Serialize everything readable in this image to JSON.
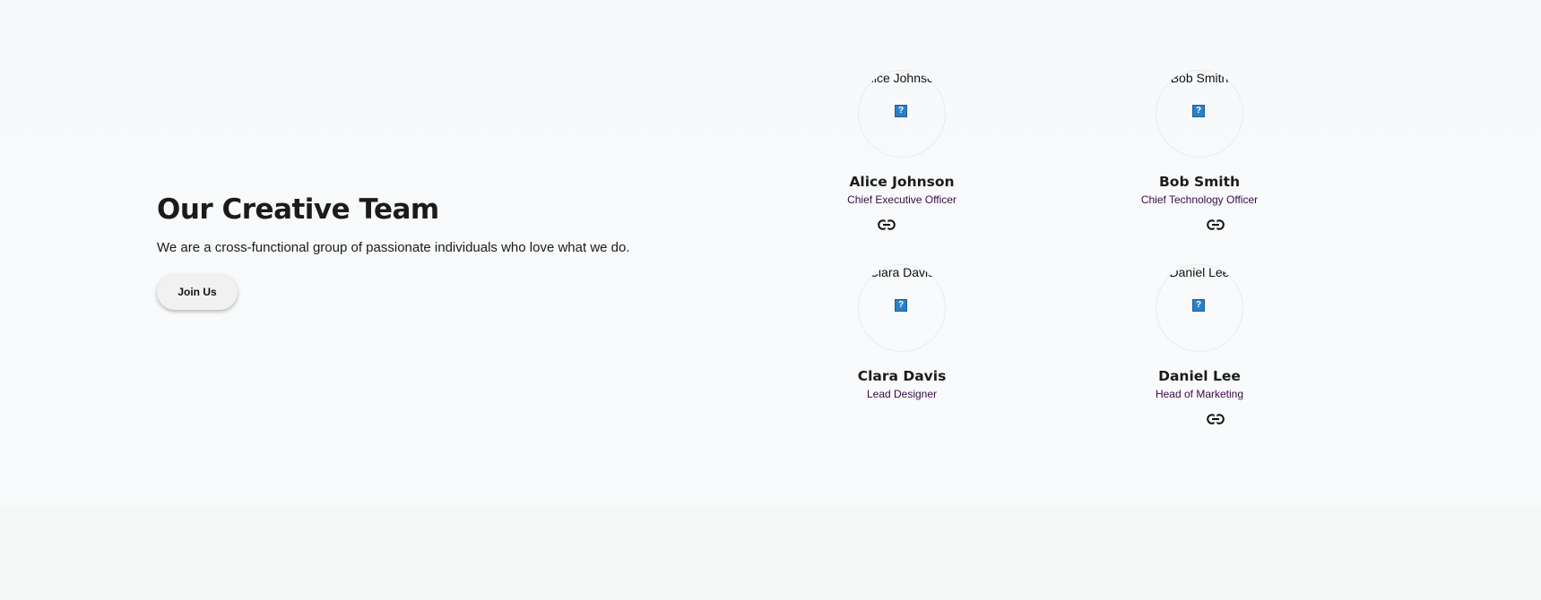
{
  "intro": {
    "title": "Our Creative Team",
    "description": "We are a cross-functional group of passionate individuals who love what we do.",
    "cta_label": "Join Us"
  },
  "team": [
    {
      "photo_alt": "Alice Johnson",
      "name": "Alice Johnson",
      "role": "Chief Executive Officer",
      "has_link": true,
      "link_icon": "link-icon"
    },
    {
      "photo_alt": "Bob Smith",
      "name": "Bob Smith",
      "role": "Chief Technology Officer",
      "has_link": true,
      "link_icon": "link-icon"
    },
    {
      "photo_alt": "Clara Davis",
      "name": "Clara Davis",
      "role": "Lead Designer",
      "has_link": false
    },
    {
      "photo_alt": "Daniel Lee",
      "name": "Daniel Lee",
      "role": "Head of Marketing",
      "has_link": true,
      "link_icon": "link-icon"
    }
  ],
  "colors": {
    "role_text": "#3a0a46",
    "heading": "#1b1b1b",
    "button_bg": "#f1f1f1",
    "broken_image_icon": "#2b7fc7"
  }
}
